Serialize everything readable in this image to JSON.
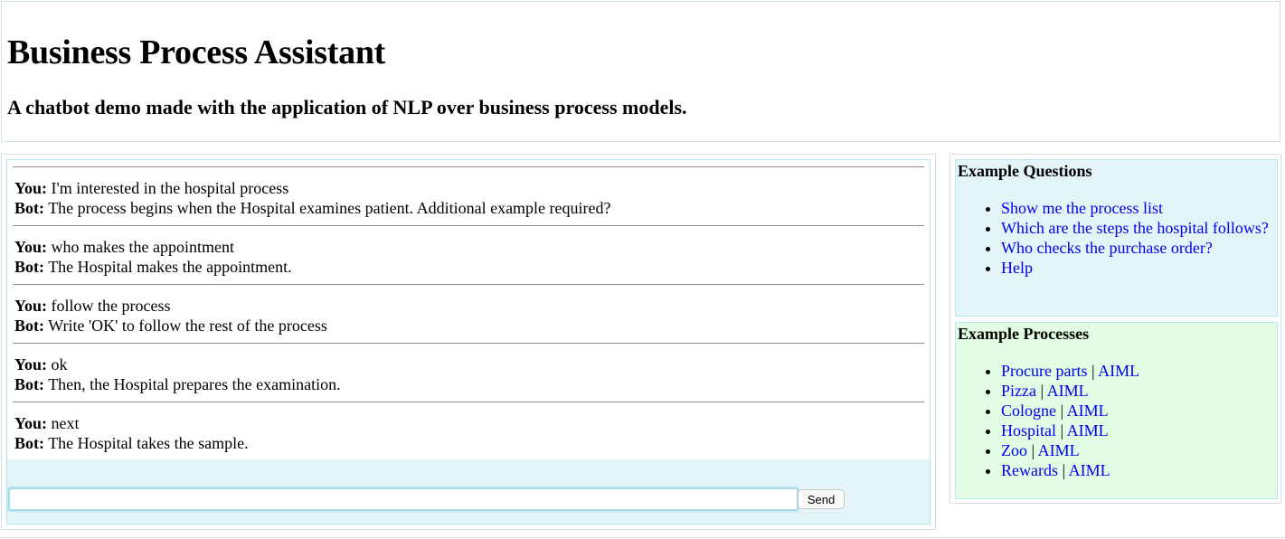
{
  "header": {
    "title": "Business Process Assistant",
    "subtitle": "A chatbot demo made with the application of NLP over business process models."
  },
  "chat": {
    "user_label": "You:",
    "bot_label": "Bot:",
    "messages": [
      {
        "user": "I'm interested in the hospital process",
        "bot": "The process begins when the Hospital examines patient. Additional example required?"
      },
      {
        "user": "who makes the appointment",
        "bot": "The Hospital makes the appointment."
      },
      {
        "user": "follow the process",
        "bot": "Write 'OK' to follow the rest of the process"
      },
      {
        "user": "ok",
        "bot": "Then, the Hospital prepares the examination."
      },
      {
        "user": "next",
        "bot": "The Hospital takes the sample."
      }
    ],
    "input_value": "",
    "send_label": "Send"
  },
  "sidebar": {
    "questions_title": "Example Questions",
    "questions": [
      "Show me the process list",
      "Which are the steps the hospital follows?",
      "Who checks the purchase order?",
      "Help"
    ],
    "processes_title": "Example Processes",
    "separator": "|",
    "processes": [
      {
        "name": "Procure parts",
        "aiml": "AIML"
      },
      {
        "name": "Pizza",
        "aiml": "AIML"
      },
      {
        "name": "Cologne",
        "aiml": "AIML"
      },
      {
        "name": "Hospital",
        "aiml": "AIML"
      },
      {
        "name": "Zoo",
        "aiml": "AIML"
      },
      {
        "name": "Rewards",
        "aiml": "AIML"
      }
    ]
  },
  "colors": {
    "link": "#0000ee",
    "chat_input_bg": "#e3f5f8",
    "questions_bg": "#e3f5f8",
    "processes_bg": "#e2fde3",
    "border": "#b8e7ef"
  }
}
